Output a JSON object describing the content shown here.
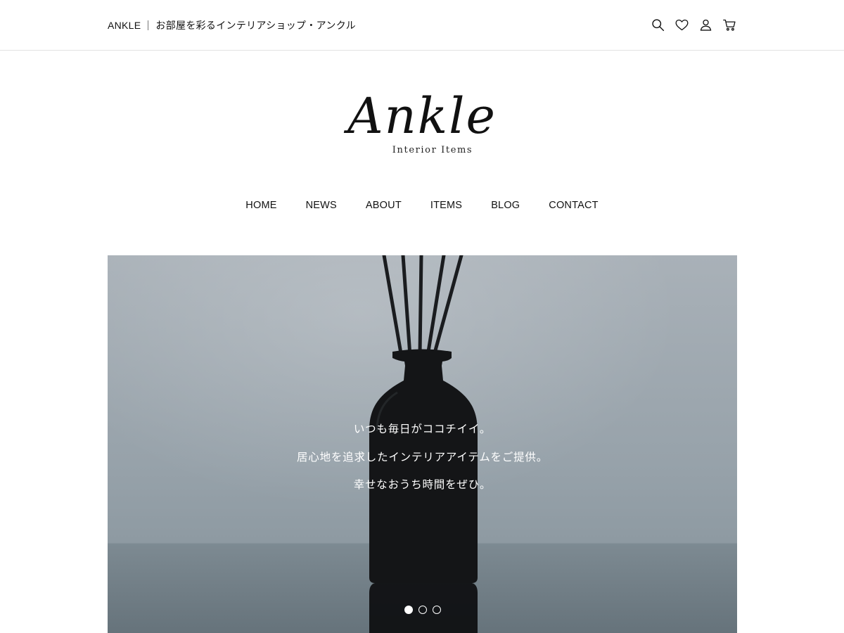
{
  "header": {
    "brand": "ANKLE",
    "tagline": "お部屋を彩るインテリアショップ・アンクル",
    "icons": [
      "search-icon",
      "heart-icon",
      "user-icon",
      "cart-icon"
    ]
  },
  "logo": {
    "script": "Ankle",
    "subtitle": "Interior Items"
  },
  "nav": {
    "items": [
      {
        "label": "HOME"
      },
      {
        "label": "NEWS"
      },
      {
        "label": "ABOUT"
      },
      {
        "label": "ITEMS"
      },
      {
        "label": "BLOG"
      },
      {
        "label": "CONTACT"
      }
    ]
  },
  "hero": {
    "lines": [
      "いつも毎日がココチイイ。",
      "居心地を追求したインテリアアイテムをご提供。",
      "幸せなおうち時間をぜひ。"
    ],
    "slide_count": 3,
    "active_slide": 1
  },
  "colors": {
    "text": "#111111",
    "hero_overlay_text": "#ffffff",
    "divider": "#e2e2e2"
  }
}
